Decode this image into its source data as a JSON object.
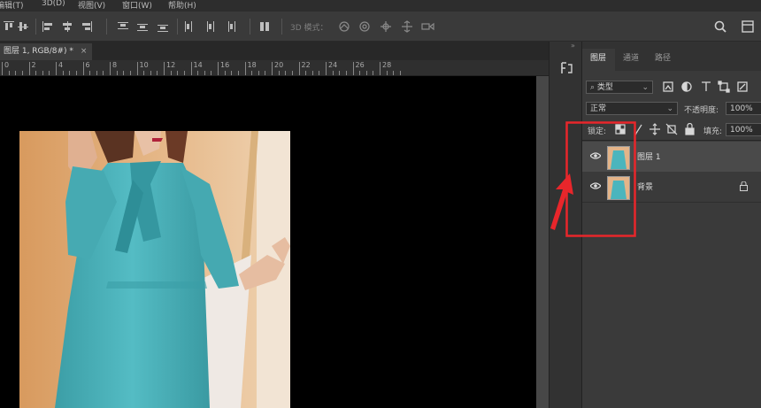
{
  "menu": [
    "编辑(T)",
    "3D(D)",
    "视图(V)",
    "窗口(W)",
    "帮助(H)"
  ],
  "options_bar": {
    "mode_3d_label": "3D 模式："
  },
  "document_tab": {
    "title": "图层 1, RGB/8#) *",
    "close": "×"
  },
  "ruler_labels": [
    "0",
    "2",
    "4",
    "6",
    "8",
    "10",
    "12",
    "14",
    "16",
    "18",
    "20",
    "22",
    "24",
    "26",
    "28"
  ],
  "layers_panel": {
    "tabs": [
      "图层",
      "通道",
      "路径"
    ],
    "filter_kind": "类型",
    "blend_mode": "正常",
    "opacity_label": "不透明度:",
    "opacity_value": "100%",
    "lock_label": "锁定:",
    "fill_label": "填充:",
    "fill_value": "100%",
    "layers": [
      {
        "name": "图层 1",
        "selected": true,
        "locked": false
      },
      {
        "name": "背景",
        "selected": false,
        "locked": true
      }
    ]
  },
  "annotation": {
    "color": "#e8262b"
  },
  "colors": {
    "panel_bg": "#3a3a3a",
    "canvas": "#000000",
    "dress": "#4bb5bd",
    "selected_row": "#4a4a4a"
  }
}
